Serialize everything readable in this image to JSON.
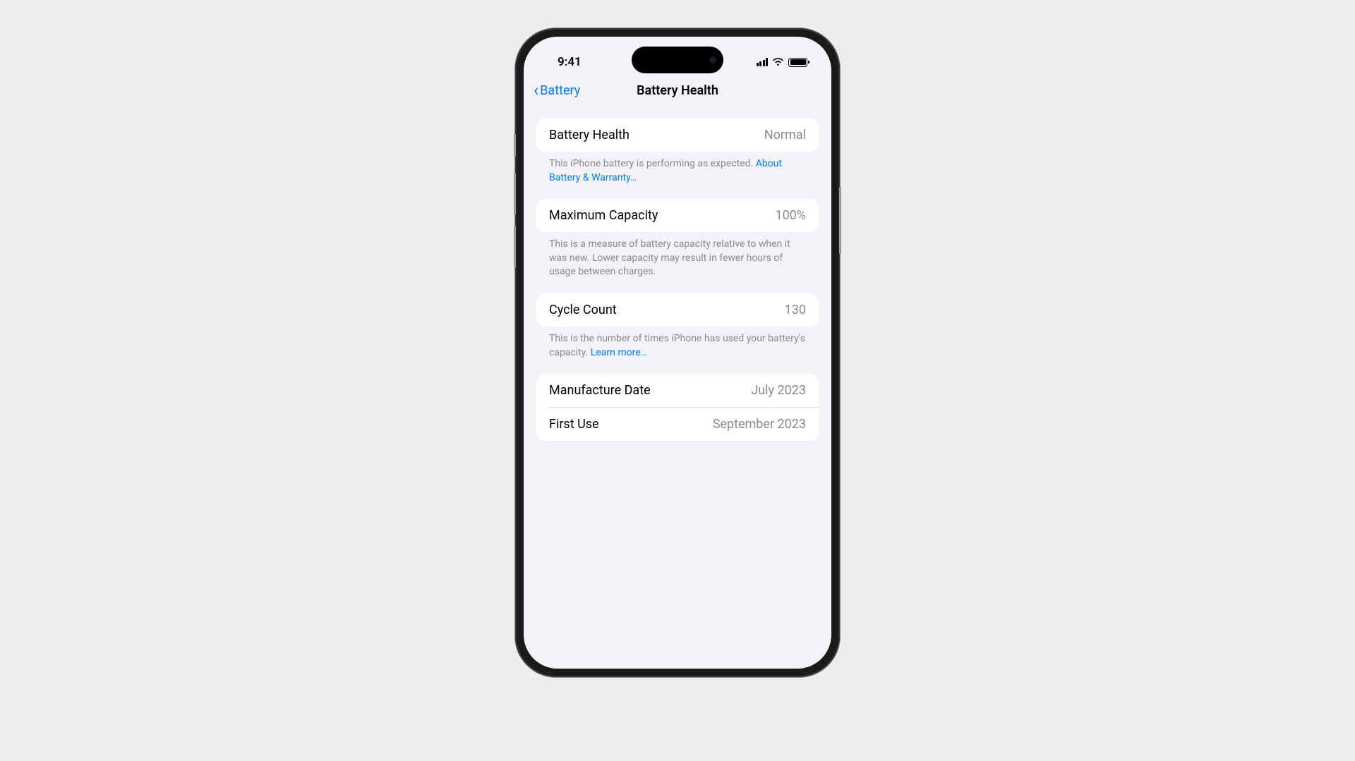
{
  "status_bar": {
    "time": "9:41"
  },
  "nav": {
    "back_label": "Battery",
    "title": "Battery Health"
  },
  "sections": {
    "battery_health": {
      "label": "Battery Health",
      "value": "Normal",
      "footer_text": "This iPhone battery is performing as expected. ",
      "footer_link": "About Battery & Warranty…"
    },
    "maximum_capacity": {
      "label": "Maximum Capacity",
      "value": "100%",
      "footer_text": "This is a measure of battery capacity relative to when it was new. Lower capacity may result in fewer hours of usage between charges."
    },
    "cycle_count": {
      "label": "Cycle Count",
      "value": "130",
      "footer_text": "This is the number of times iPhone has used your battery's capacity. ",
      "footer_link": "Learn more…"
    },
    "dates": {
      "manufacture_label": "Manufacture Date",
      "manufacture_value": "July 2023",
      "first_use_label": "First Use",
      "first_use_value": "September 2023"
    }
  }
}
